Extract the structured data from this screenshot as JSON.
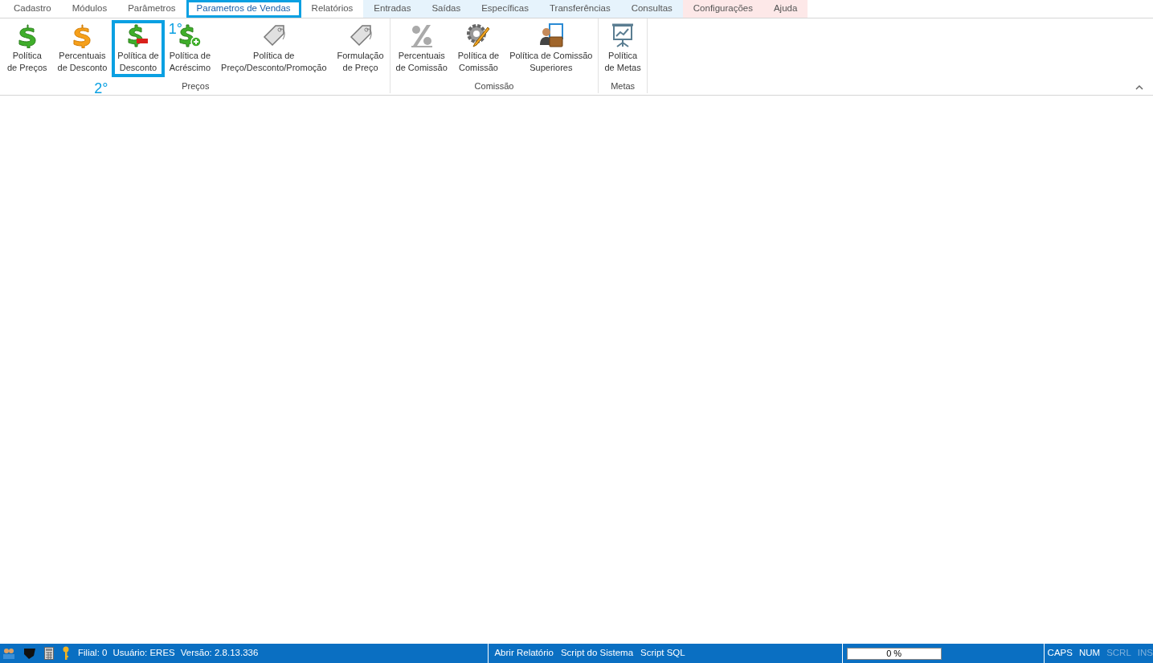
{
  "tabs": [
    {
      "label": "Cadastro",
      "selected": false,
      "color": "#ffffff"
    },
    {
      "label": "Módulos",
      "selected": false,
      "color": "#ffffff"
    },
    {
      "label": "Parâmetros",
      "selected": false,
      "color": "#ffffff"
    },
    {
      "label": "Parametros de Vendas",
      "selected": true,
      "color": "#ffffff",
      "highlighted": true
    },
    {
      "label": "Relatórios",
      "selected": false,
      "color": "#ffffff"
    },
    {
      "label": "Entradas",
      "selected": false,
      "color": "#e6f3fc"
    },
    {
      "label": "Saídas",
      "selected": false,
      "color": "#e6f3fc"
    },
    {
      "label": "Específicas",
      "selected": false,
      "color": "#e6f3fc"
    },
    {
      "label": "Transferências",
      "selected": false,
      "color": "#e6f3fc"
    },
    {
      "label": "Consultas",
      "selected": false,
      "color": "#e6f3fc"
    },
    {
      "label": "Configurações",
      "selected": false,
      "color": "#fde8e8"
    },
    {
      "label": "Ajuda",
      "selected": false,
      "color": "#fde8e8"
    }
  ],
  "ribbon_groups": [
    {
      "label": "Preços",
      "items": [
        {
          "kind": "dollar-green",
          "lines": [
            "Política",
            "de Preços"
          ],
          "highlighted": false
        },
        {
          "kind": "dollar-orange",
          "lines": [
            "Percentuais",
            "de Desconto"
          ],
          "highlighted": false
        },
        {
          "kind": "dollar-minus",
          "lines": [
            "Política de",
            "Desconto"
          ],
          "highlighted": true,
          "annotation": {
            "text": "2°",
            "kind": "below"
          }
        },
        {
          "kind": "dollar-plus",
          "lines": [
            "Política de",
            "Acréscimo"
          ],
          "highlighted": false,
          "annotation": {
            "text": "1°",
            "kind": "corner"
          }
        },
        {
          "kind": "tag",
          "lines": [
            "Política de",
            "Preço/Desconto/Promoção"
          ],
          "highlighted": false
        },
        {
          "kind": "tag",
          "lines": [
            "Formulação",
            "de Preço"
          ],
          "highlighted": false
        }
      ]
    },
    {
      "label": "Comissão",
      "items": [
        {
          "kind": "percent",
          "lines": [
            "Percentuais",
            "de Comissão"
          ],
          "highlighted": false
        },
        {
          "kind": "gear-pencil",
          "lines": [
            "Política de",
            "Comissão"
          ],
          "highlighted": false
        },
        {
          "kind": "person-briefcase",
          "lines": [
            "Política de Comissão",
            "Superiores"
          ],
          "highlighted": false
        }
      ]
    },
    {
      "label": "Metas",
      "items": [
        {
          "kind": "board",
          "lines": [
            "Política",
            "de Metas"
          ],
          "highlighted": false
        }
      ]
    }
  ],
  "status_bar": {
    "info": [
      "Filial: 0",
      "Usuário: ERES",
      "Versão: 2.8.13.336"
    ],
    "links": [
      "Abrir Relatório",
      "Script do Sistema",
      "Script SQL"
    ],
    "progress": {
      "level": 0,
      "reading": "0 %"
    },
    "indicators": [
      {
        "label": "CAPS",
        "on": true
      },
      {
        "label": "NUM",
        "on": true
      },
      {
        "label": "SCRL",
        "on": false
      },
      {
        "label": "INS",
        "on": false
      }
    ]
  }
}
